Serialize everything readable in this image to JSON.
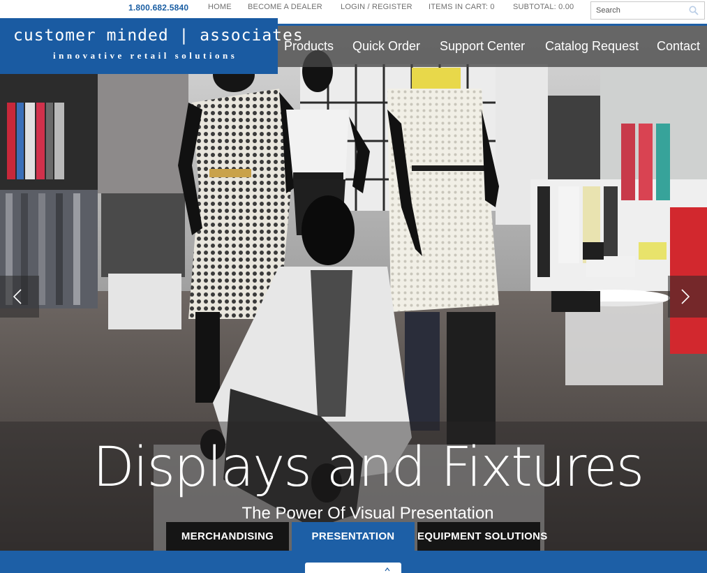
{
  "topbar": {
    "phone": "1.800.682.5840",
    "home": "HOME",
    "dealer": "BECOME A DEALER",
    "login": "LOGIN / REGISTER",
    "cart": "ITEMS IN CART: 0",
    "subtotal": "SUBTOTAL: 0.00",
    "search_placeholder": "Search"
  },
  "brand": {
    "name": "customer minded | associates",
    "tagline": "innovative retail solutions"
  },
  "nav": {
    "products": "Products",
    "quick_order": "Quick Order",
    "support": "Support Center",
    "catalog": "Catalog Request",
    "contact": "Contact"
  },
  "hero": {
    "headline": "Displays and Fixtures",
    "subheadline": "The Power Of Visual Presentation"
  },
  "tabs": {
    "merchandising": "MERCHANDISING",
    "presentation": "PRESENTATION",
    "equipment": "EQUIPMENT SOLUTIONS"
  },
  "colors": {
    "brand_blue": "#1d5fa6",
    "nav_overlay": "#464646"
  }
}
